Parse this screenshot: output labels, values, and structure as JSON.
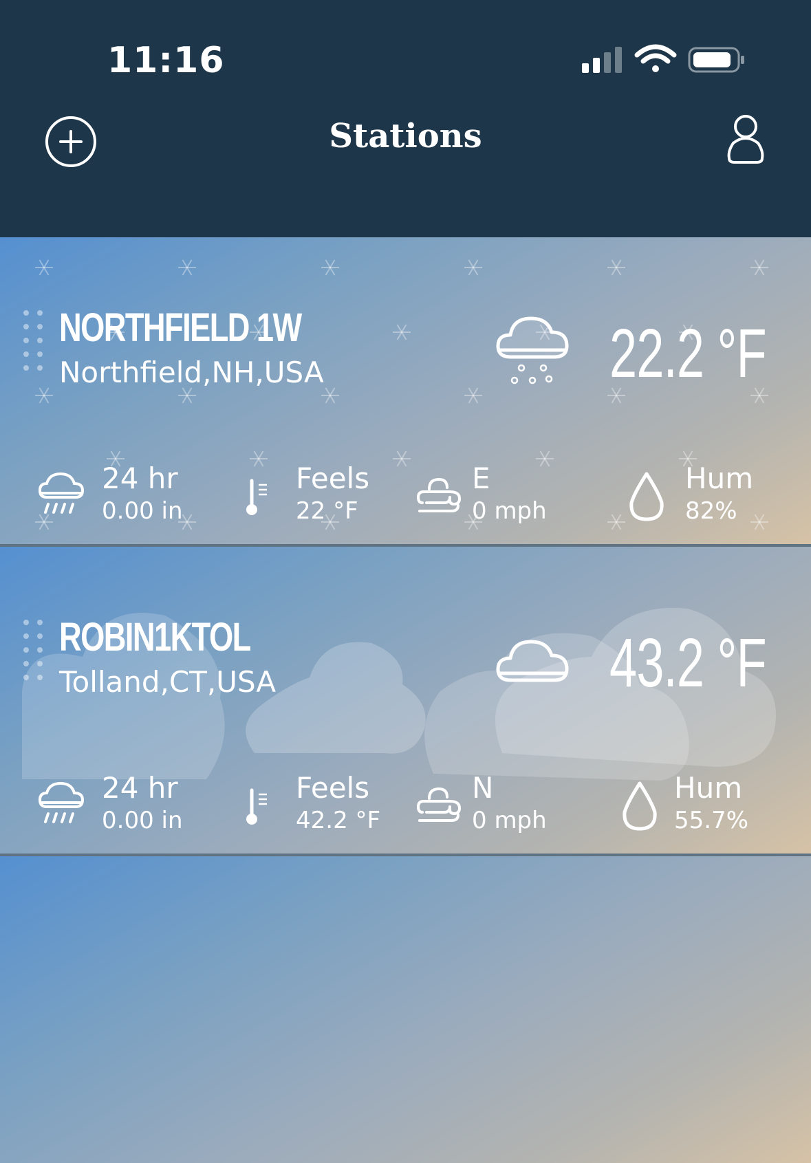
{
  "status_bar": {
    "time": "11:16"
  },
  "nav": {
    "title": "Stations"
  },
  "stations": [
    {
      "name": "NORTHFIELD 1W",
      "location": "Northfield,NH,USA",
      "condition_icon": "snow-cloud-icon",
      "temperature": "22.2 °F",
      "rain_label": "24 hr",
      "rain_value": "0.00 in",
      "feels_label": "Feels",
      "feels_value": "22 °F",
      "wind_label": "E",
      "wind_value": "0 mph",
      "hum_label": "Hum",
      "hum_value": "82%"
    },
    {
      "name": "ROBIN1KTOL",
      "location": "Tolland,CT,USA",
      "condition_icon": "cloud-icon",
      "temperature": "43.2 °F",
      "rain_label": "24 hr",
      "rain_value": "0.00 in",
      "feels_label": "Feels",
      "feels_value": "42.2 °F",
      "wind_label": "N",
      "wind_value": "0 mph",
      "hum_label": "Hum",
      "hum_value": "55.7%"
    }
  ],
  "colors": {
    "header": "#1d3649",
    "card_gradient_start": "#5590d0",
    "card_gradient_end": "#d6c2a6",
    "text": "#ffffff"
  }
}
